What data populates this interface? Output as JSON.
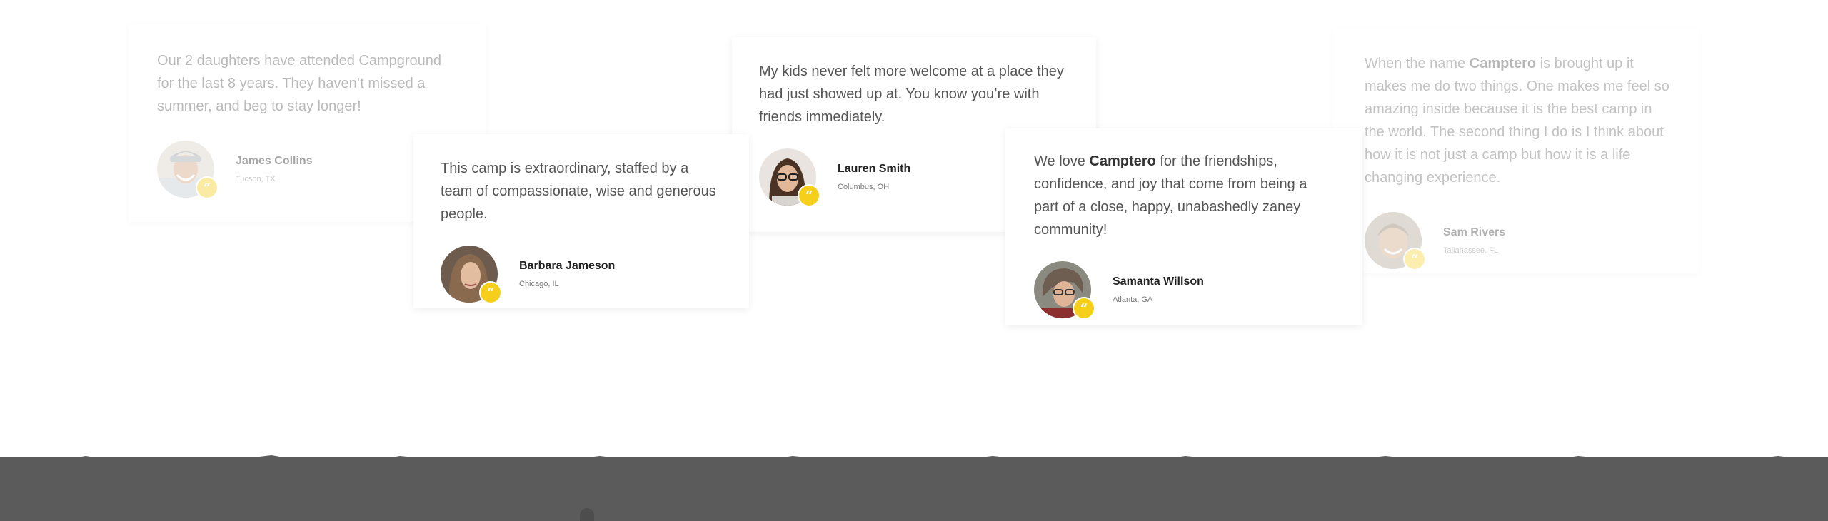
{
  "testimonials": [
    {
      "quote": "Our 2 daughters have attended Campground for the last 8 years. They haven’t missed a summer, and  beg to stay longer!",
      "name": "James Collins",
      "location": "Tucson, TX"
    },
    {
      "quote": "This camp is extraordinary, staffed by a team of compassionate, wise and generous people.",
      "name": "Barbara Jameson",
      "location": "Chicago, IL"
    },
    {
      "quote": "My kids never felt more welcome at a place they had just showed up at. You know you’re with friends immediately.",
      "name": "Lauren Smith",
      "location": "Columbus, OH"
    },
    {
      "quote_before": "We love ",
      "quote_brand": "Camptero",
      "quote_after": " for the friendships, confidence, and joy that come from being a part of a close, happy, unabashedly zaney community!",
      "name": "Samanta Willson",
      "location": "Atlanta, GA"
    },
    {
      "quote_before": "When the name ",
      "quote_brand": "Camptero",
      "quote_after": "  is brought up it makes me do two things. One makes me feel so amazing inside because it is the best camp in the world. The second thing I do is I think about how it is not just a camp but how it is a life changing  experience.",
      "name": "Sam Rivers",
      "location": "Tallahassee, FL"
    }
  ],
  "badge_glyph": "“",
  "colors": {
    "accent": "#f6cf1a",
    "band": "#5b5b5c"
  }
}
